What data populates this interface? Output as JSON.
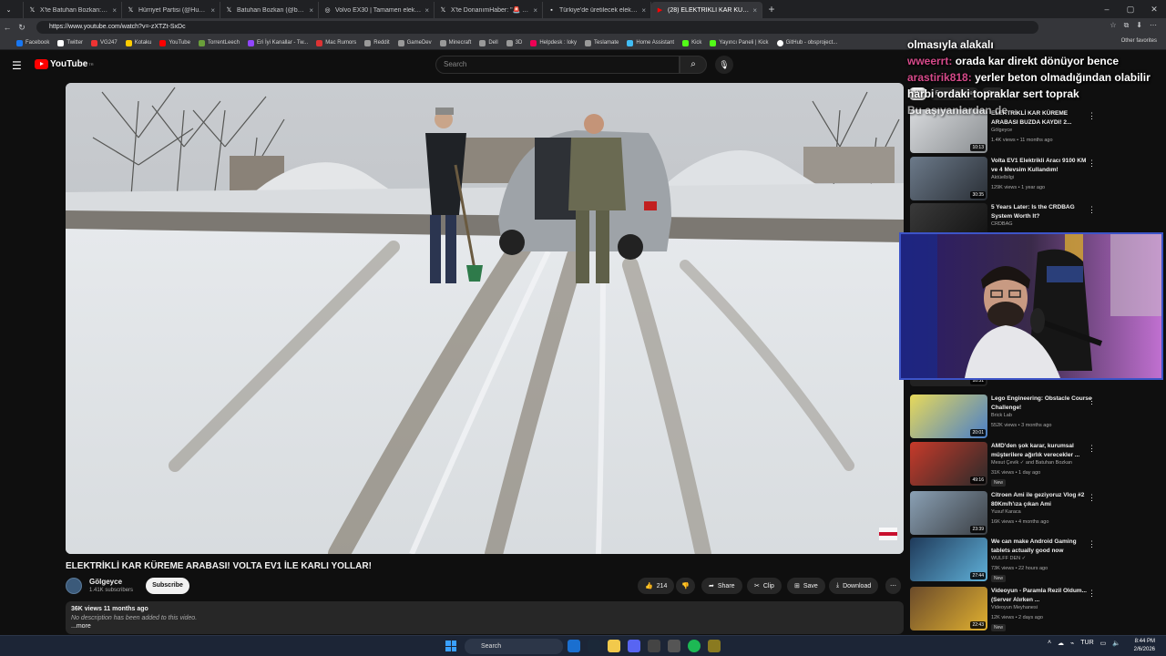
{
  "browser": {
    "tabs": [
      {
        "label": "X'te Batuhan Bozkan: \"Paypal, Ap",
        "icon": "x-icon"
      },
      {
        "label": "Hürriyet Partisi (@HurriyetPartiliTr",
        "icon": "x-icon"
      },
      {
        "label": "Batuhan Bozkan (@batubozkan) /",
        "icon": "x-icon"
      },
      {
        "label": "Volvo EX30 | Tamamen elektrikli k",
        "icon": "globe-icon"
      },
      {
        "label": "X'te DonanımHaber: \"🚨 Yurtdışı",
        "icon": "x-icon"
      },
      {
        "label": "Türkiye'de üretilecek elektrikli Hy",
        "icon": "site-icon"
      },
      {
        "label": "(28) ELEKTRİKLİ KAR KÜREME",
        "icon": "youtube-icon",
        "active": true
      }
    ],
    "url": "https://www.youtube.com/watch?v=-zXTZt-SxDc",
    "bookmarks": [
      "Facebook",
      "Twitter",
      "VG247",
      "Kotaku",
      "YouTube",
      "TorrentLeech",
      "Eri İyi Kanallar - Tw...",
      "Mac Rumors",
      "Reddit",
      "GameDev",
      "Minecraft",
      "Dell",
      "3D",
      "Helpdesk : loky",
      "Teslamate",
      "Home Assistant",
      "Kick",
      "Yayıncı Paneli | Kick",
      "GitHub - obsproject...",
      "Other favorites"
    ]
  },
  "youtube": {
    "logo": "YouTube",
    "logo_country": "TR",
    "search_placeholder": "Search",
    "video": {
      "title": "ELEKTRİKLİ KAR KÜREME ARABASI! VOLTA EV1 İLE KARLI YOLLAR!",
      "channel": "Gölgeyce",
      "subscribers": "1.41K subscribers",
      "subscribe_label": "Subscribe",
      "likes": "214",
      "share": "Share",
      "clip": "Clip",
      "save": "Save",
      "download": "Download",
      "views_date": "36K views  11 months ago",
      "description": "No description has been added to this video.",
      "more": "...more"
    },
    "chips": [
      "All",
      "From Gölgeyce",
      "Cars"
    ],
    "recommendations": [
      {
        "title": "ELEKTRİKLİ KAR KÜREME ARABASI BUZDA KAYDI! 2...",
        "channel": "Gölgeyce",
        "views": "1.4K views • 11 months ago",
        "duration": "10:13",
        "new": false
      },
      {
        "title": "Volta EV1 Elektrikli Aracı 9100 KM ve 4 Mevsim Kullandım!",
        "channel": "Aktüelbilgi",
        "views": "129K views • 1 year ago",
        "duration": "30:35",
        "new": false
      },
      {
        "title": "5 Years Later: Is the CRDBAG System Worth It?",
        "channel": "CRDBAG",
        "views": "",
        "duration": "",
        "new": false
      },
      {
        "title": "Lego Engineering: Obstacle Course Challenge!",
        "channel": "Brick Lab",
        "views": "552K views • 3 months ago",
        "duration": "20:01",
        "new": false
      },
      {
        "title": "AMD'den şok karar, kurumsal müşterilere ağırlık verecekler ...",
        "channel": "Mesut Çevik ✓ and Batuhan Bozkan",
        "views": "31K views • 1 day ago",
        "duration": "49:16",
        "new": true
      },
      {
        "title": "Citroen Ami ile geziyoruz Vlog #2 80Km/h'ıza çıkan Ami",
        "channel": "Yusuf Karaca",
        "views": "16K views • 4 months ago",
        "duration": "23:39",
        "new": false
      },
      {
        "title": "We can make Android Gaming tablets actually good now",
        "channel": "WULFF DEN ✓",
        "views": "73K views • 22 hours ago",
        "duration": "27:44",
        "new": true
      },
      {
        "title": "Videoyun - Paramla Rezil Oldum... (Server Alırken ...",
        "channel": "Videoyun Meyhanesi",
        "views": "12K views • 2 days ago",
        "duration": "22:43",
        "new": true
      }
    ],
    "hidden_duration": "10:31",
    "new_badge": "New"
  },
  "chat_overlay": [
    {
      "user": "",
      "msg": "olmasıyla alakalı"
    },
    {
      "user": "wweerrt:",
      "msg": "orada kar direkt dönüyor bence"
    },
    {
      "user": "arastirik818:",
      "msg": "yerler beton olmadığından olabilir"
    },
    {
      "user": "",
      "msg": "harbi ordaki topraklar sert toprak"
    },
    {
      "user": "",
      "msg": "Bu aşıyanlardan de"
    }
  ],
  "taskbar": {
    "search": "Search",
    "lang": "TUR",
    "time": "8:44 PM",
    "date": "2/6/2026"
  },
  "colors": {
    "accent": "#ff0000",
    "webcam_border": "#3d54c8",
    "chat_user": "#d64a8a"
  }
}
